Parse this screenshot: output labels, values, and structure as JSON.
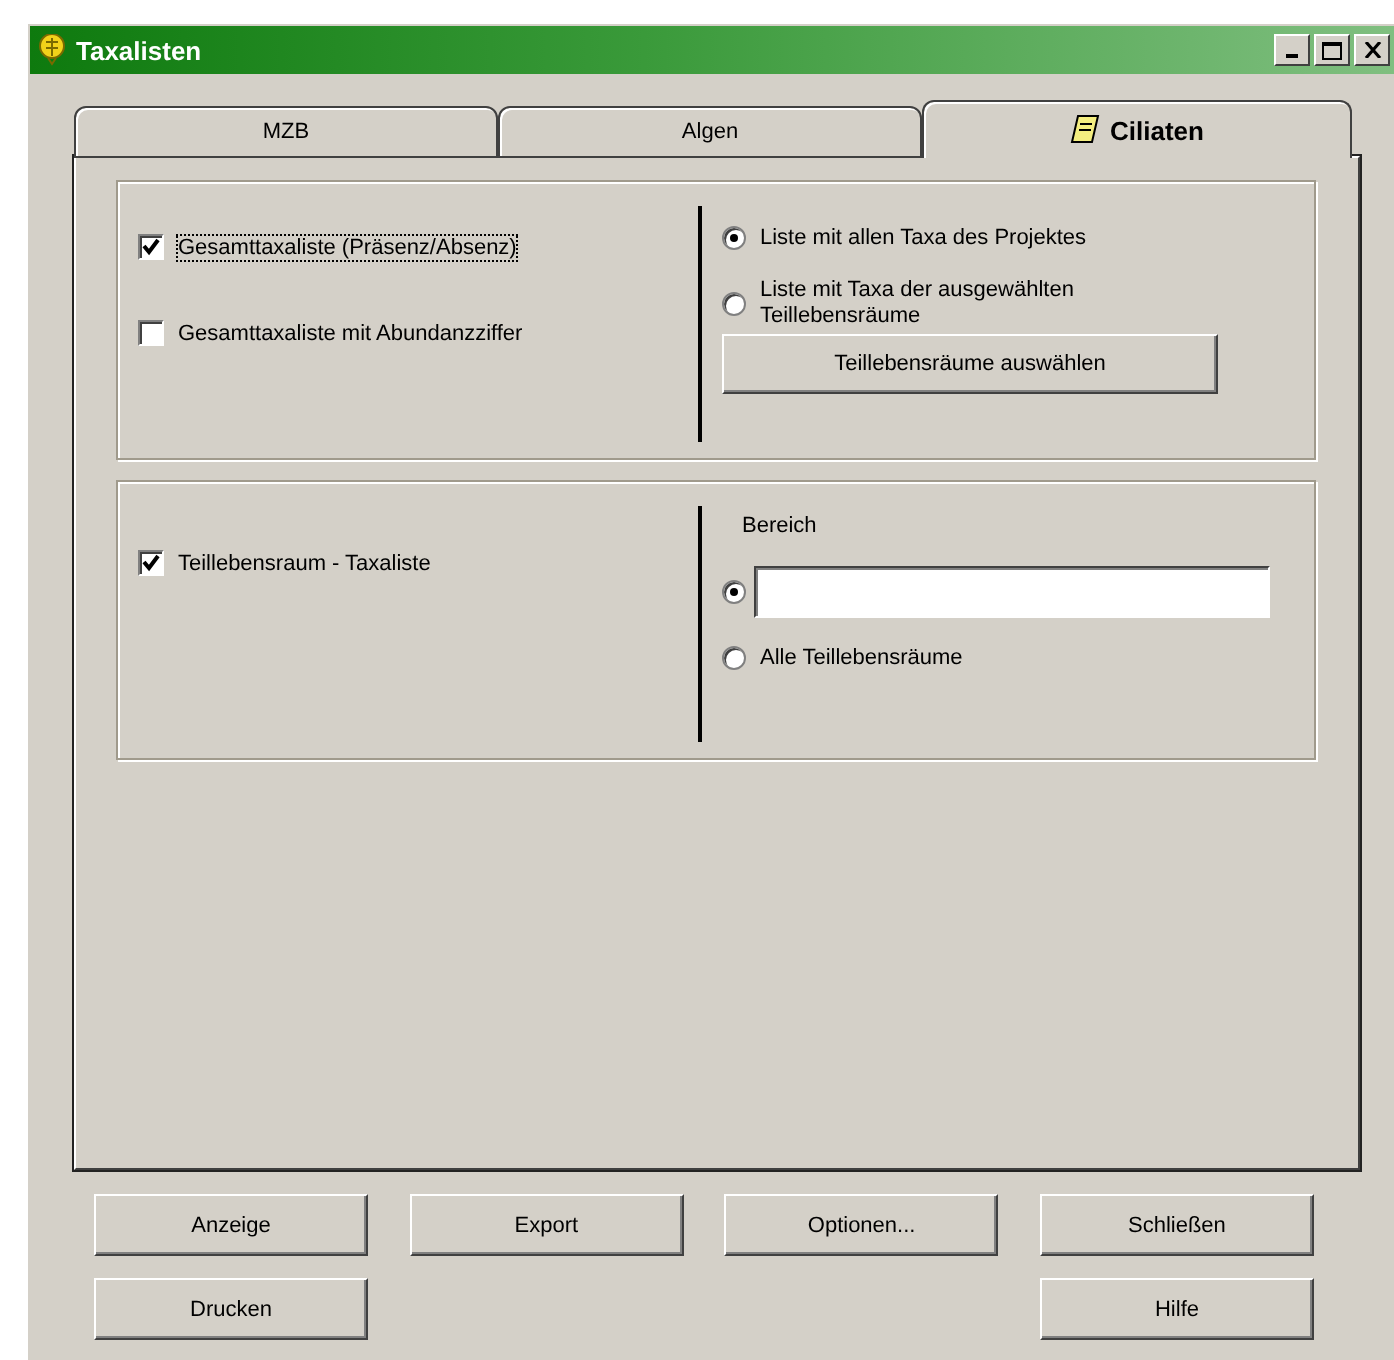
{
  "window": {
    "title": "Taxalisten"
  },
  "tabs": [
    {
      "label": "MZB",
      "selected": false
    },
    {
      "label": "Algen",
      "selected": false
    },
    {
      "label": "Ciliaten",
      "selected": true
    }
  ],
  "overall_list": {
    "checkboxes": [
      {
        "label": "Gesamttaxaliste (Präsenz/Absenz)",
        "checked": true,
        "focused": true
      },
      {
        "label": "Gesamttaxaliste mit Abundanzziffer",
        "checked": false,
        "focused": false
      }
    ],
    "radios": [
      {
        "label": "Liste mit allen Taxa des Projektes",
        "selected": true
      },
      {
        "label": "Liste mit Taxa der ausgewählten Teillebensräume",
        "selected": false
      }
    ],
    "button": "Teillebensräume auswählen"
  },
  "habitat_list": {
    "checkbox": {
      "label": "Teillebensraum - Taxaliste",
      "checked": true
    },
    "range_label": "Bereich",
    "radios": [
      {
        "kind": "field",
        "selected": true
      },
      {
        "kind": "label",
        "label": "Alle Teillebensräume",
        "selected": false
      }
    ]
  },
  "button_rows": [
    [
      "Anzeige",
      "Export",
      "Optionen...",
      "Schließen"
    ],
    [
      "Drucken",
      "Hilfe"
    ]
  ]
}
